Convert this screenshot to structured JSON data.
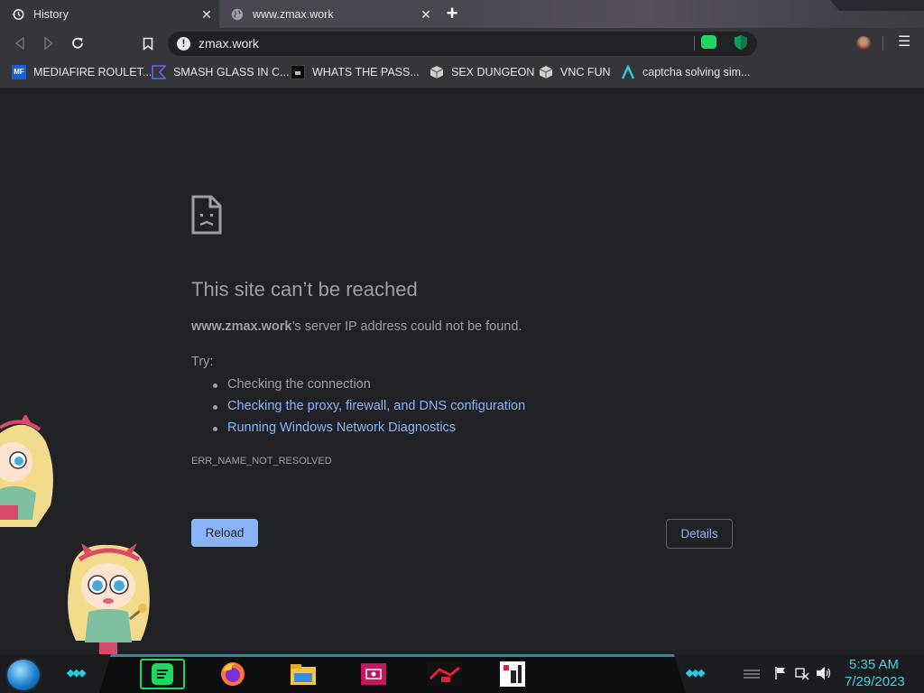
{
  "tabs": [
    {
      "title": "History",
      "icon": "history-icon",
      "active": true
    },
    {
      "title": "www.zmax.work",
      "icon": "globe-icon",
      "active": false
    }
  ],
  "omnibox": {
    "url": "zmax.work"
  },
  "bookmarks": [
    {
      "label": "MEDIAFIRE ROULET...",
      "icon": "mediafire-icon"
    },
    {
      "label": "SMASH GLASS IN C...",
      "icon": "smash-icon"
    },
    {
      "label": "WHATS THE PASS...",
      "icon": "dark-site-icon"
    },
    {
      "label": "SEX DUNGEON",
      "icon": "cube-icon"
    },
    {
      "label": "VNC FUN",
      "icon": "cube-icon"
    },
    {
      "label": "captcha solving sim...",
      "icon": "lambda-icon"
    }
  ],
  "error": {
    "heading": "This site can’t be reached",
    "host": "www.zmax.work",
    "message": "’s server IP address could not be found.",
    "try_label": "Try:",
    "suggestions": [
      {
        "text": "Checking the connection",
        "link": false
      },
      {
        "text": "Checking the proxy, firewall, and DNS configuration",
        "link": true
      },
      {
        "text": "Running Windows Network Diagnostics",
        "link": true
      }
    ],
    "code": "ERR_NAME_NOT_RESOLVED",
    "reload_label": "Reload",
    "details_label": "Details"
  },
  "taskbar": {
    "apps": [
      "spotify-icon",
      "firefox-icon",
      "file-explorer-icon",
      "media-app-icon",
      "game-app-icon",
      "pixel-app-icon"
    ],
    "time": "5:35 AM",
    "date": "7/29/2023"
  },
  "colors": {
    "accent": "#8ab4f8",
    "page_bg": "#202124",
    "text_muted": "#9aa0a6",
    "taskbar_accent": "#2cc6e0"
  }
}
